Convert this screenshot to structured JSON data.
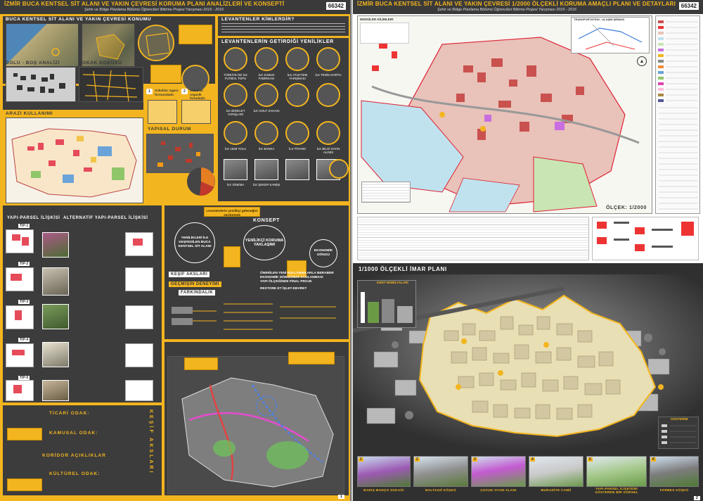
{
  "left": {
    "title": "İZMİR BUCA KENTSEL SİT ALANI VE YAKIN ÇEVRESİ KORUMA PLANI ANALİZLERİ VE KONSEPTİ",
    "subtitle": "Şehir ve Bölge Planlama Bölümü Öğrencileri Bitirme Projesi Yarışması 2015 - 2016",
    "code": "66342",
    "sections": {
      "location": "BUCA KENTSEL SİT ALANI VE YAKIN ÇEVRESİ KONUMU",
      "levantines": "LEVANTENLER KİMLERDİR?",
      "innovations": "LEVANTENLERİN GETİRDİĞİ YENİLİKLER",
      "fill_empty": "DOLU - BOŞ ANALİZİ",
      "street": "SOKAK DOKUSU",
      "land_use": "ARAZİ KULLANIMI",
      "structural": "YAPISAL DURUM",
      "parcel": "YAPI-PARSEL İLİŞKİSİ",
      "alt_parcel": "ALTERNATİF YAPI-PARSEL İLİŞKİSİ",
      "concept": "KONSEPT"
    },
    "street_types": [
      "Sokaklar ızgara formundadır.",
      "Sokaklar organik formdadır."
    ],
    "innovation_captions": [
      "TÜRKİYE DE İLK FUTBOL TOPU",
      "İLK SABUN FABRİKASI",
      "İLK ATLETİZM YARIŞMASI",
      "İLK TENİS KORTU",
      "İLK BİSİKLET YARIŞLARI",
      "İLK GOLF SAHASI",
      "İLK 1839 YOLU",
      "İLK BANKA",
      "İLK PİYANO",
      "İLK BİLGİ SATIN ALINDI",
      "İLK SİNEMA",
      "İLK ŞEKER KAMIŞI"
    ],
    "tips": [
      "TİP-1",
      "TİP-2",
      "TİP-3",
      "TİP-4",
      "TİP-5"
    ],
    "concept_items": {
      "renew": "YENİLİKLERİ İLE KEŞFEDİLEN BUCA KENTSEL SİT ALANI",
      "innovative": "YENİLİKÇİ KORUMA YAKLAŞIMI",
      "economy": "EKONOMİK DÖNGÜ",
      "keşif": "KEŞİF AKSLARI",
      "past": "GEÇMİŞİN DENEYİMİ",
      "aware": "FARKINDALIK",
      "bullets": [
        "ÖNERİLEN YENİ KULLANIMLARLA BERABER EKONOMİK DÖNGÜNÜN SAĞLANMASI",
        "YAPI ÖLÇEĞİNDE FİNAL PROJE",
        "RESTORE ET İŞLET-DEVRET"
      ],
      "levantine_box": "Levantenlerin yenilikçi geleneğini sürdürmek"
    },
    "foci": {
      "title": "KEŞİF AKSLARI",
      "items": [
        "TİCARİ ODAK:",
        "KAMUSAL ODAK:",
        "KORİDOR AÇIKLIKLAR",
        "KÜLTÜREL ODAK:"
      ]
    },
    "page": "1"
  },
  "right": {
    "title": "İZMİR BUCA KENTSEL SİT ALANI VE YAKIN ÇEVRESİ 1/2000 ÖLÇEKLİ KORUMA AMAÇLI PLANI VE DETAYLARI",
    "subtitle": "Şehir ve Bölge Planlama Bölümü Öğrencileri Bitirme Projesi Yarışması 2015 - 2016",
    "code": "66342",
    "legend_title": "MODÜLER KİLİMLERİ",
    "transport_title": "TRANSPORTATİON - ULAŞIM ŞEMASI",
    "scale": "ÖLÇEK: 1/2000",
    "plan_title": "1/1000 ÖLÇEKLİ İMAR PLANI",
    "furniture": "KENT MOBİLYALARI",
    "gosterim": "GÖSTERİM",
    "photos": [
      "BARIŞ MANÇO SOKAĞI",
      "BALTAZZİ KÖŞKÜ",
      "ÇOCUK OYUN ALANI",
      "MURADİYE CAMİİ",
      "YAPI-PARSEL İLİŞKİSİNİ GÖSTEREN BİR GÖRSEL",
      "FORBES KÖŞKÜ"
    ],
    "photo_nums": [
      "1",
      "2",
      "3",
      "4",
      "5",
      "6"
    ],
    "page": "2"
  }
}
